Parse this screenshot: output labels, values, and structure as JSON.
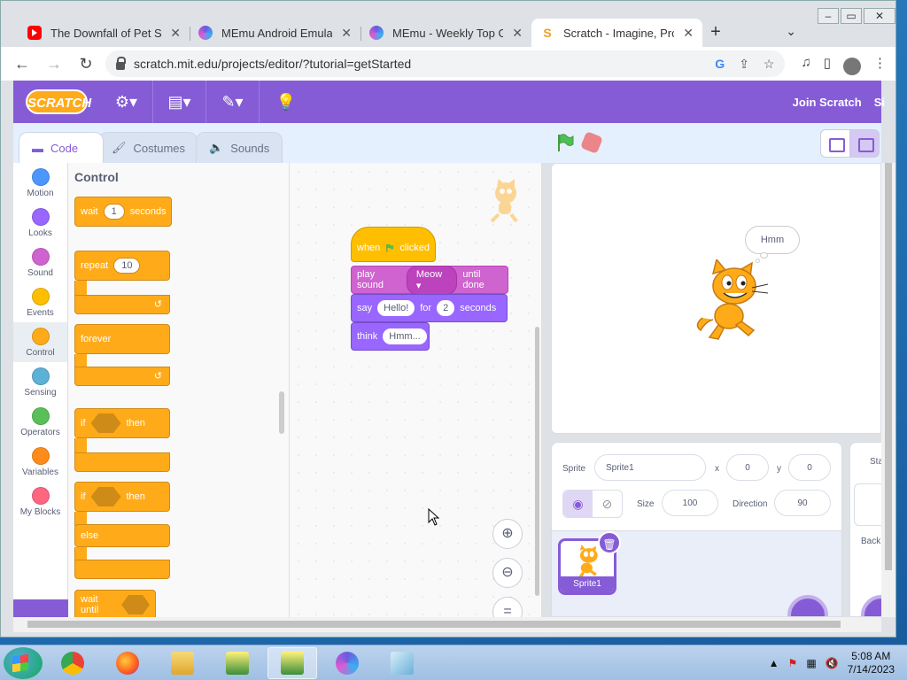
{
  "browser": {
    "tabs": [
      {
        "title": "The Downfall of Pet Sim",
        "icon": "youtube-icon"
      },
      {
        "title": "MEmu Android Emulator",
        "icon": "memu-icon"
      },
      {
        "title": "MEmu - Weekly Top Gam",
        "icon": "memu-icon"
      },
      {
        "title": "Scratch - Imagine, Progr",
        "icon": "scratch-icon",
        "active": true
      }
    ],
    "url": "scratch.mit.edu/projects/editor/?tutorial=getStarted"
  },
  "menubar": {
    "logo": "SCRATCH",
    "join": "Join Scratch",
    "signin": "Si"
  },
  "editor_tabs": {
    "code": "Code",
    "costumes": "Costumes",
    "sounds": "Sounds"
  },
  "categories": [
    {
      "label": "Motion",
      "color": "#4c97ff"
    },
    {
      "label": "Looks",
      "color": "#9966ff"
    },
    {
      "label": "Sound",
      "color": "#cf63cf"
    },
    {
      "label": "Events",
      "color": "#ffbf00"
    },
    {
      "label": "Control",
      "color": "#ffab19",
      "active": true
    },
    {
      "label": "Sensing",
      "color": "#5cb1d6"
    },
    {
      "label": "Operators",
      "color": "#59c059"
    },
    {
      "label": "Variables",
      "color": "#ff8c1a"
    },
    {
      "label": "My Blocks",
      "color": "#ff6680"
    }
  ],
  "palette": {
    "title": "Control",
    "wait": {
      "label": "wait",
      "value": "1",
      "suffix": "seconds"
    },
    "repeat": {
      "label": "repeat",
      "value": "10"
    },
    "forever": "forever",
    "if_then": {
      "if": "if",
      "then": "then"
    },
    "if_else": {
      "if": "if",
      "then": "then",
      "else": "else"
    },
    "wait_until": "wait until"
  },
  "script": {
    "hat": {
      "when": "when",
      "clicked": "clicked"
    },
    "play_sound": {
      "label": "play sound",
      "sound": "Meow",
      "suffix": "until done"
    },
    "say": {
      "label": "say",
      "text": "Hello!",
      "for": "for",
      "secs": "2",
      "suffix": "seconds"
    },
    "think": {
      "label": "think",
      "text": "Hmm..."
    }
  },
  "stage": {
    "bubble": "Hmm"
  },
  "sprite_info": {
    "sprite_label": "Sprite",
    "sprite_name": "Sprite1",
    "x_label": "x",
    "x": "0",
    "y_label": "y",
    "y": "0",
    "size_label": "Size",
    "size": "100",
    "direction_label": "Direction",
    "direction": "90",
    "sprites": [
      {
        "name": "Sprite1"
      }
    ]
  },
  "stage_pane": {
    "label": "Sta",
    "backdrops": "Back"
  },
  "taskbar": {
    "time": "5:08 AM",
    "date": "7/14/2023"
  },
  "colors": {
    "scratch_purple": "#855cd6",
    "control_orange": "#ffab19"
  }
}
